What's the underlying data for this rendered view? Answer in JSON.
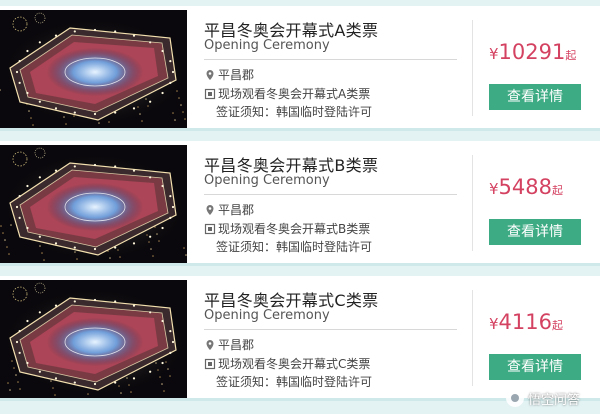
{
  "colors": {
    "accent_price": "#d44261",
    "button_bg": "#3dab84",
    "page_bg": "#e3f2f3"
  },
  "tickets": [
    {
      "title": "平昌冬奥会开幕式A类票",
      "subtitle": "Opening Ceremony",
      "location": "平昌郡",
      "detail": "现场观看冬奥会开幕式A类票",
      "visa": "签证须知：韩国临时登陆许可",
      "currency": "¥",
      "price": "10291",
      "price_unit": "起",
      "button_label": "查看详情",
      "location_icon": "map-pin-icon",
      "detail_icon": "ticket-icon"
    },
    {
      "title": "平昌冬奥会开幕式B类票",
      "subtitle": "Opening Ceremony",
      "location": "平昌郡",
      "detail": "现场观看冬奥会开幕式B类票",
      "visa": "签证须知：韩国临时登陆许可",
      "currency": "¥",
      "price": "5488",
      "price_unit": "起",
      "button_label": "查看详情",
      "location_icon": "map-pin-icon",
      "detail_icon": "ticket-icon"
    },
    {
      "title": "平昌冬奥会开幕式C类票",
      "subtitle": "Opening Ceremony",
      "location": "平昌郡",
      "detail": "现场观看冬奥会开幕式C类票",
      "visa": "签证须知：韩国临时登陆许可",
      "currency": "¥",
      "price": "4116",
      "price_unit": "起",
      "button_label": "查看详情",
      "location_icon": "map-pin-icon",
      "detail_icon": "ticket-icon"
    }
  ],
  "watermark": {
    "text": "悟空问答"
  }
}
